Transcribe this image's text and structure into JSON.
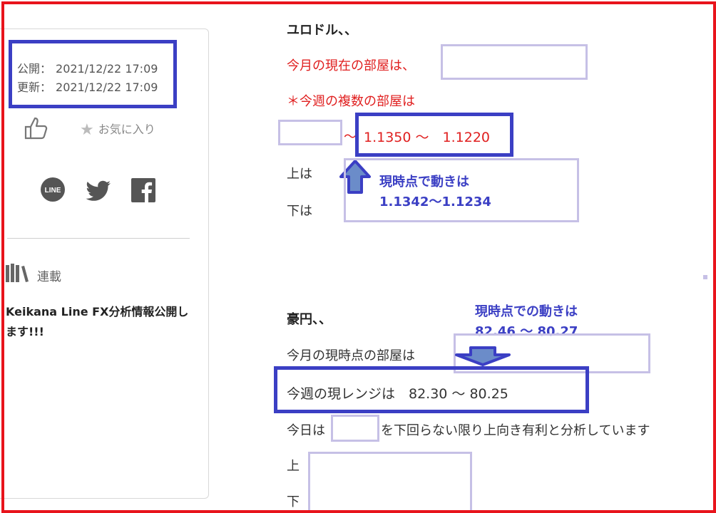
{
  "sidebar": {
    "published_label": "公開：",
    "published_date": "2021/12/22 17:09",
    "updated_label": "更新：",
    "updated_date": "2021/12/22 17:09",
    "favorite_label": "お気に入り",
    "series_label": "連載",
    "article_title": "Keikana Line FX分析情報公開します!!!",
    "line_icon_text": "LINE"
  },
  "eurusd": {
    "heading": "ユロドル、、",
    "month_room_label": "今月の現在の部屋は、",
    "week_rooms_label": "＊今週の複数の部屋は",
    "tilde": "～",
    "range": "1.1350 ～　1.1220",
    "upper_label": "上は",
    "lower_label": "下は",
    "note_line1": "現時点で動きは",
    "note_line2": "1.1342～1.1234"
  },
  "usdjpy": {
    "heading": "豪円、、",
    "note_line1": "現時点での動きは",
    "note_line2": "82.46 ～ 80.27",
    "month_room_label": "今月の現時点の部屋は",
    "week_range": "今週の現レンジは　82.30 ～ 80.25",
    "today_prefix": "今日は",
    "today_suffix": "を下回らない限り上向き有利と分析しています",
    "upper_label": "上",
    "lower_label": "下"
  },
  "colors": {
    "frame_red": "#e8141c",
    "annotation_blue": "#3b3fc4",
    "placeholder_lavender": "#c6c0e6",
    "text_red": "#e01f1f"
  }
}
